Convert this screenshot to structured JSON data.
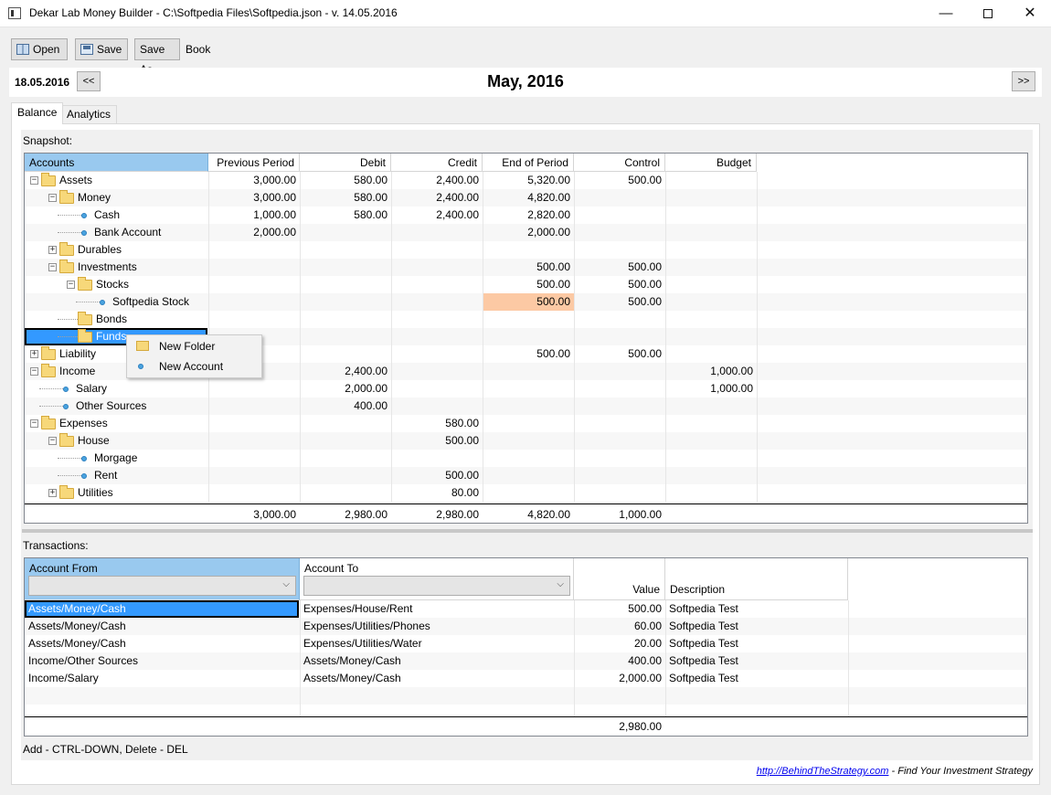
{
  "window": {
    "title": "Dekar Lab Money Builder - C:\\Softpedia Files\\Softpedia.json - v. 14.05.2016",
    "min_glyph": "—",
    "close_glyph": "✕",
    "icon": "app-icon"
  },
  "toolbar": {
    "open_label": "Open",
    "save_label": "Save",
    "save_as_label": "Save As",
    "book_label": "Book"
  },
  "datebar": {
    "date": "18.05.2016",
    "prev_label": "<<",
    "next_label": ">>",
    "month_title": "May, 2016"
  },
  "tabs": [
    {
      "label": "Balance",
      "active": true
    },
    {
      "label": "Analytics",
      "active": false
    }
  ],
  "snapshot": {
    "label": "Snapshot:",
    "columns": [
      "Accounts",
      "Previous Period",
      "Debit",
      "Credit",
      "End of Period",
      "Control",
      "Budget"
    ],
    "rows": [
      {
        "name": "Assets",
        "level": 0,
        "kind": "folder",
        "exp": "−",
        "prev": "3,000.00",
        "debit": "580.00",
        "credit": "2,400.00",
        "end": "5,320.00",
        "control": "500.00",
        "budget": ""
      },
      {
        "name": "Money",
        "level": 1,
        "kind": "folder",
        "exp": "−",
        "prev": "3,000.00",
        "debit": "580.00",
        "credit": "2,400.00",
        "end": "4,820.00",
        "control": "",
        "budget": ""
      },
      {
        "name": "Cash",
        "level": 2,
        "kind": "leaf",
        "exp": "",
        "prev": "1,000.00",
        "debit": "580.00",
        "credit": "2,400.00",
        "end": "2,820.00",
        "control": "",
        "budget": ""
      },
      {
        "name": "Bank Account",
        "level": 2,
        "kind": "leaf",
        "exp": "",
        "prev": "2,000.00",
        "debit": "",
        "credit": "",
        "end": "2,000.00",
        "control": "",
        "budget": ""
      },
      {
        "name": "Durables",
        "level": 1,
        "kind": "folder",
        "exp": "+",
        "prev": "",
        "debit": "",
        "credit": "",
        "end": "",
        "control": "",
        "budget": ""
      },
      {
        "name": "Investments",
        "level": 1,
        "kind": "folder",
        "exp": "−",
        "prev": "",
        "debit": "",
        "credit": "",
        "end": "500.00",
        "control": "500.00",
        "budget": ""
      },
      {
        "name": "Stocks",
        "level": 2,
        "kind": "folder",
        "exp": "−",
        "prev": "",
        "debit": "",
        "credit": "",
        "end": "500.00",
        "control": "500.00",
        "budget": ""
      },
      {
        "name": "Softpedia Stock",
        "level": 3,
        "kind": "leaf",
        "exp": "",
        "prev": "",
        "debit": "",
        "credit": "",
        "end": "500.00",
        "control": "500.00",
        "budget": "",
        "highlight": true
      },
      {
        "name": "Bonds",
        "level": 2,
        "kind": "folder",
        "exp": "",
        "prev": "",
        "debit": "",
        "credit": "",
        "end": "",
        "control": "",
        "budget": ""
      },
      {
        "name": "Funds",
        "level": 2,
        "kind": "folder",
        "exp": "",
        "prev": "",
        "debit": "",
        "credit": "",
        "end": "",
        "control": "",
        "budget": "",
        "selected": true
      },
      {
        "name": "Liability",
        "level": 0,
        "kind": "folder",
        "exp": "+",
        "prev": "",
        "debit": "",
        "credit": "",
        "end": "500.00",
        "control": "500.00",
        "budget": ""
      },
      {
        "name": "Income",
        "level": 0,
        "kind": "folder",
        "exp": "−",
        "prev": "",
        "debit": "2,400.00",
        "credit": "",
        "end": "",
        "control": "",
        "budget": "1,000.00"
      },
      {
        "name": "Salary",
        "level": 1,
        "kind": "leaf",
        "exp": "",
        "prev": "",
        "debit": "2,000.00",
        "credit": "",
        "end": "",
        "control": "",
        "budget": "1,000.00"
      },
      {
        "name": "Other Sources",
        "level": 1,
        "kind": "leaf",
        "exp": "",
        "prev": "",
        "debit": "400.00",
        "credit": "",
        "end": "",
        "control": "",
        "budget": ""
      },
      {
        "name": "Expenses",
        "level": 0,
        "kind": "folder",
        "exp": "−",
        "prev": "",
        "debit": "",
        "credit": "580.00",
        "end": "",
        "control": "",
        "budget": ""
      },
      {
        "name": "House",
        "level": 1,
        "kind": "folder",
        "exp": "−",
        "prev": "",
        "debit": "",
        "credit": "500.00",
        "end": "",
        "control": "",
        "budget": ""
      },
      {
        "name": "Morgage",
        "level": 2,
        "kind": "leaf",
        "exp": "",
        "prev": "",
        "debit": "",
        "credit": "",
        "end": "",
        "control": "",
        "budget": ""
      },
      {
        "name": "Rent",
        "level": 2,
        "kind": "leaf",
        "exp": "",
        "prev": "",
        "debit": "",
        "credit": "500.00",
        "end": "",
        "control": "",
        "budget": ""
      },
      {
        "name": "Utilities",
        "level": 1,
        "kind": "folder",
        "exp": "+",
        "prev": "",
        "debit": "",
        "credit": "80.00",
        "end": "",
        "control": "",
        "budget": ""
      }
    ],
    "totals": {
      "prev": "3,000.00",
      "debit": "2,980.00",
      "credit": "2,980.00",
      "end": "4,820.00",
      "control": "1,000.00"
    }
  },
  "context_menu": {
    "items": [
      {
        "label": "New Folder",
        "icon": "new-folder-icon"
      },
      {
        "label": "New Account",
        "icon": "new-account-icon"
      }
    ]
  },
  "transactions": {
    "label": "Transactions:",
    "columns": {
      "from": "Account From",
      "to": "Account To",
      "value": "Value",
      "description": "Description"
    },
    "filter_from": "",
    "filter_to": "",
    "rows": [
      {
        "from": "Assets/Money/Cash",
        "to": "Expenses/House/Rent",
        "value": "500.00",
        "description": "Softpedia Test",
        "selected": true
      },
      {
        "from": "Assets/Money/Cash",
        "to": "Expenses/Utilities/Phones",
        "value": "60.00",
        "description": "Softpedia Test"
      },
      {
        "from": "Assets/Money/Cash",
        "to": "Expenses/Utilities/Water",
        "value": "20.00",
        "description": "Softpedia Test"
      },
      {
        "from": "Income/Other Sources",
        "to": "Assets/Money/Cash",
        "value": "400.00",
        "description": "Softpedia Test"
      },
      {
        "from": "Income/Salary",
        "to": "Assets/Money/Cash",
        "value": "2,000.00",
        "description": "Softpedia Test"
      }
    ],
    "total": "2,980.00"
  },
  "status": {
    "hint": "Add - CTRL-DOWN, Delete - DEL"
  },
  "footer": {
    "link": "http://BehindTheStrategy.com",
    "tagline": " - Find Your Investment Strategy"
  },
  "colors": {
    "selection": "#3399ff",
    "header_selected": "#99c9ef",
    "highlight": "#fcc9a4",
    "folder": "#f7d87a",
    "leaf": "#4aa3df"
  }
}
